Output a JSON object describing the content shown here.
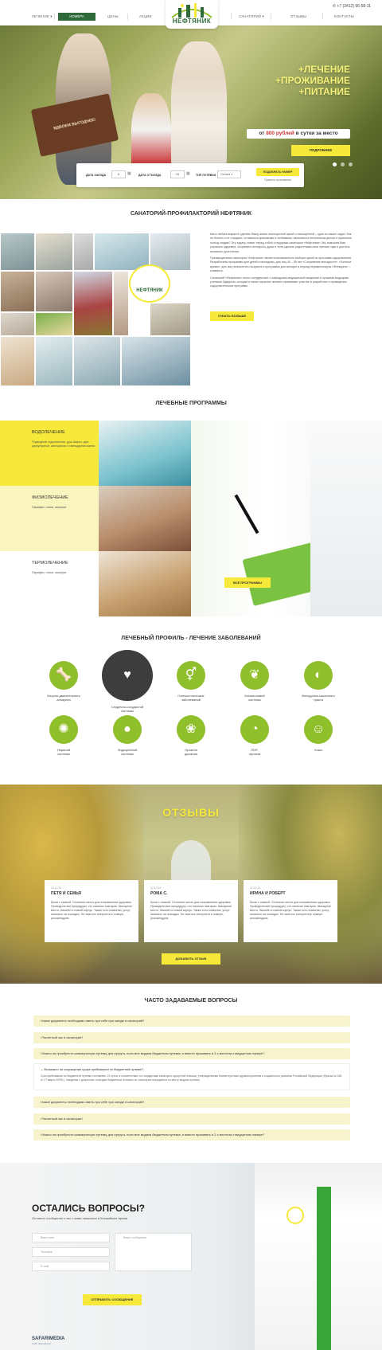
{
  "header": {
    "nav_left": [
      "ЛЕЧЕНИЕ",
      "НОМЕРА",
      "ЦЕНЫ",
      "АКЦИИ"
    ],
    "nav_right": [
      "САНАТОРИЙ",
      "ОТЗЫВЫ",
      "КОНТАКТЫ"
    ],
    "phone": "+7 (3412) 66-58-11",
    "logo_text": "НЕФТЯНИК"
  },
  "hero": {
    "line1": "+ЛЕЧЕНИЕ",
    "line2": "+ПРОЖИВАНИЕ",
    "line3": "+ПИТАНИЕ",
    "price_prefix": "от ",
    "price_value": "800 рублей",
    "price_suffix": " в сутки за место",
    "more_label": "ПОДРОБНЕЕ",
    "sign_text": "ВДВОЕМ ВЫГОДНЕЕ!"
  },
  "booking": {
    "arrival_label": "ДАТА ЗАЕЗДА",
    "arrival_value": "8",
    "departure_label": "ДАТА ОТЪЕЗДА",
    "departure_value": "15",
    "voucher_label": "ТИП ПУТЁВКИ",
    "voucher_value": "Оплата",
    "submit_label": "ПОДОБРАТЬ НОМЕР",
    "link_label": "Правила проживания"
  },
  "about": {
    "title": "САНАТОРИЙ-ПРОФИЛАКТОРИЙ НЕФТЯНИК",
    "p1": "Как в любом возрасте сделать Вашу жизнь полноценной яркой и насыщенной – одна из наших задач. Как не болеть и не страдать, оставаться красивыми и любимыми, заниматься интересным делом и приносить пользу людям? Эту задачу ставит перед собой сотрудники санатория «Нефтяник». Мы поможем Вам улучшить здоровье, сохранить молодость души и тела сделать радостными свои зрелые годы и достичь активного долголетия.",
    "p2": "Преимуществом санатория «Нефтяник» является возможность выбора одной из программ оздоровления. Разработаны программы для детей и молодежи, для лиц 40 – 55 лет «Сохранение молодости», «Золотое время», для лиц пенсионного возраста и программа для женщин в период перименопаузы «Женщина» – климакса.",
    "p3": "Санаторий «Нефтяник» тесно сотрудничает с кафедрами медицинской академии и лучшими ведущими учеными Удмуртии, которые в своих отраслях активно принимают участие в разработке и проведении оздоровительных программ.",
    "button": "УЗНАТЬ БОЛЬШЕ"
  },
  "programs": {
    "title": "ЛЕЧЕБНЫЕ ПРОГРАММЫ",
    "items": [
      {
        "title": "ВОДОЛЕЧЕНИЕ",
        "desc": "Подводный гидромассаж, душ Шарко, душ циркулярный, жемчужная и скипидарная ванна"
      },
      {
        "title": "ФИЗИОЛЕЧЕНИЕ",
        "desc": "Парафин, глина, озокерит"
      },
      {
        "title": "ТЕРМОЛЕЧЕНИЕ",
        "desc": "Парафин, глина, озокерит"
      }
    ],
    "button": "ВСЕ ПРОГРАММЫ"
  },
  "profile": {
    "title": "ЛЕЧЕБНЫЙ ПРОФИЛЬ - ЛЕЧЕНИЕ ЗАБОЛЕВАНИЙ",
    "items": [
      {
        "label1": "Опорно-двигательного",
        "label2": "аппарата",
        "icon": "joint-icon"
      },
      {
        "label1": "Сердечно-сосудистой",
        "label2": "системы",
        "icon": "heart-icon"
      },
      {
        "label1": "Гинекологических",
        "label2": "заболеваний",
        "icon": "gender-icon"
      },
      {
        "label1": "Мочеполовой",
        "label2": "системы",
        "icon": "kidney-icon"
      },
      {
        "label1": "Желудочно-кишечного",
        "label2": "тракта",
        "icon": "stomach-icon"
      },
      {
        "label1": "Нервной",
        "label2": "системы",
        "icon": "brain-icon"
      },
      {
        "label1": "Эндокринной",
        "label2": "системы",
        "icon": "apple-icon"
      },
      {
        "label1": "Органов",
        "label2": "дыхания",
        "icon": "lungs-icon"
      },
      {
        "label1": "ЛОР-",
        "label2": "органов",
        "icon": "ear-icon"
      },
      {
        "label1": "Кожи",
        "label2": "",
        "icon": "skin-icon"
      }
    ]
  },
  "reviews": {
    "title": "ОТЗЫВЫ",
    "items": [
      {
        "date": "12.12.14",
        "name": "ПЕТЯ И СЕМЬЯ",
        "text": "Были с семьей. Отличное место для поправления здоровья. Проводили все процедуры, что написал нам врач. Шикарное место, бассейн и новый корпус. Также есть комнатки, услуг, катались на лошадях. Не хватило интернета в номере, рекомендуем."
      },
      {
        "date": "12.12.14",
        "name": "РОМА С.",
        "text": "Были с семьей. Отличное место для поправления здоровья. Проводили все процедуры, что написал нам врач. Шикарное место, бассейн и новый корпус. Также есть комнатки, услуг, катались на лошадях. Не хватило интернета в номере, рекомендуем."
      },
      {
        "date": "12.12.14",
        "name": "ИРИНА И РОБЕРТ",
        "text": "Были с семьей. Отличное место для поправления здоровья. Проводили все процедуры, что написал нам врач. Шикарное место, бассейн и новый корпус. Также есть комнатки, услуг, катались на лошадях. Не хватило интернета в номере, рекомендуем."
      }
    ],
    "button": "ДОБАВИТЬ ОТЗЫВ"
  },
  "faq": {
    "title": "ЧАСТО ЗАДАВАЕМЫЕ ВОПРОСЫ",
    "q1": "Какие документы необходимо иметь при себе при заезде в санаторий?",
    "q2": "Расчетный час в санатории?",
    "q3": "Можно ли приобрести коммерческую путевку для супруга, если мне выдана бюджетная путевка, и вместе проживать в 2-х местном стандартном номере?",
    "q4": "Возможно ли сокращение срока пребывания по бюджетной путевке?",
    "a4": "Срок пребывания по бюджетной путевке составляет 21 сутки, в соответствии со стандартами санаторно-курортной помощи, утвержденными Министерством здравоохранения и социального развития Российской Федерации (Приказ № 186 от 27 марта 2009г.). Сведения о досрочных отъездах бюджетных больных по санаторию передаются по месту выдачи путевки.",
    "q5": "Какие документы необходимо иметь при себе при заезде в санаторий?",
    "q6": "Расчетный час в санатории?",
    "q7": "Можно ли приобрести коммерческую путевку для супруга, если мне выдана бюджетная путевка, и вместе проживать в 2-х местном стандартном номере?"
  },
  "contact": {
    "title": "ОСТАЛИСЬ ВОПРОСЫ?",
    "subtitle": "Оставьте сообщение и мы с вами свяжемся в ближайшее время",
    "name_placeholder": "Ваше имя",
    "phone_placeholder": "Телефон",
    "email_placeholder": "E-mail",
    "message_placeholder": "Ваше сообщение",
    "button": "ОТПРАВИТЬ СООБЩЕНИЕ",
    "brand": "SAFARIMEDIA",
    "brand_sub": "Сайт разработан"
  },
  "colors": {
    "accent_yellow": "#f6e93a",
    "brand_green": "#2f6b3a",
    "icon_green": "#8fbf2a",
    "active_icon": "#3d3d3d"
  }
}
